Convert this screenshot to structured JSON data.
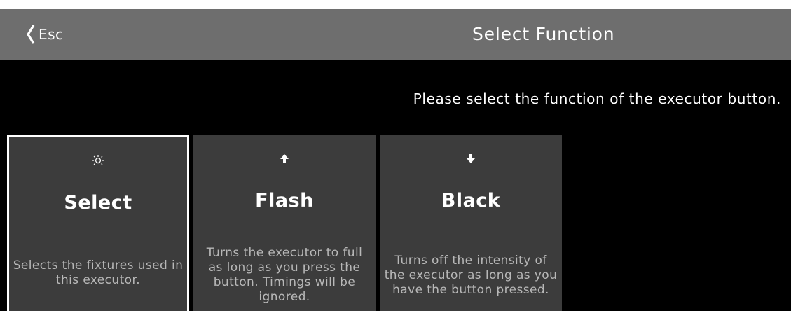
{
  "header": {
    "esc_label": "Esc",
    "esc_icon": "chevron-left-icon",
    "title": "Select Function",
    "bar_color": "#6e6e6e"
  },
  "instruction": "Please select the function of the executor button.",
  "options": [
    {
      "icon": "lightbulb-icon",
      "label": "Select",
      "description": "Selects the fixtures used in this executor.",
      "selected": true
    },
    {
      "icon": "arrow-up-icon",
      "label": "Flash",
      "description": "Turns the executor to full as long as you press the button. Timings will be ignored.",
      "selected": false
    },
    {
      "icon": "arrow-down-icon",
      "label": "Black",
      "description": "Turns off the intensity of the executor as long as you have the button pressed.",
      "selected": false
    }
  ],
  "colors": {
    "background": "#000000",
    "tile": "#3c3c3c",
    "selected_border": "#ffffff",
    "description_text": "#b8b8b8"
  }
}
